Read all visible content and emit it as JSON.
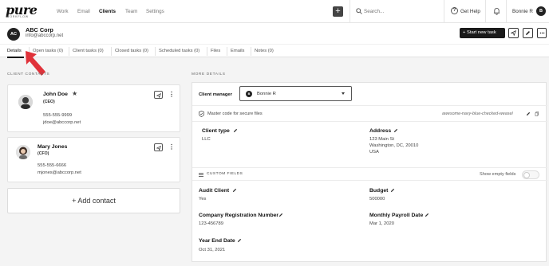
{
  "brand": {
    "logo_word": "pure",
    "logo_sub": "WORKFLOW"
  },
  "nav": {
    "links": [
      "Work",
      "Email",
      "Clients",
      "Team",
      "Settings"
    ],
    "search_placeholder": "Search...",
    "help_label": "Get Help",
    "user_name": "Bonnie R",
    "user_initial": "B"
  },
  "client": {
    "initials": "AC",
    "name": "ABC Corp",
    "email": "info@abccorp.net",
    "start_task_label": "+ Start new task"
  },
  "tabs": [
    "Details",
    "Open tasks (0)",
    "Client tasks (0)",
    "Closed tasks (0)",
    "Scheduled tasks (0)",
    "Files",
    "Emails",
    "Notes (0)"
  ],
  "contacts_section": {
    "title": "CLIENT CONTACTS",
    "contacts": [
      {
        "name": "John Doe",
        "role": "(CEO)",
        "phone": "555-555-9999",
        "email": "jdoe@abccorp.net"
      },
      {
        "name": "Mary Jones",
        "role": "(CFO)",
        "phone": "555-555-6666",
        "email": "mjones@abccorp.net"
      }
    ],
    "add_label": "+ Add contact"
  },
  "details": {
    "title": "MORE DETAILS",
    "client_manager_label": "Client manager",
    "client_manager_value": "Bonnie R",
    "client_manager_initial": "B",
    "master_code_label": "Master code for secure files",
    "master_code_value": "awesome-navy-blue-checked-weasel",
    "client_type_label": "Client type",
    "client_type_value": "LLC",
    "address_label": "Address",
    "address_line1": "123 Main St",
    "address_line2": "Washington, DC, 20010",
    "address_line3": "USA",
    "custom_fields_label": "CUSTOM FIELDS",
    "show_empty_label": "Show empty fields",
    "custom_fields": [
      {
        "label": "Audit Client",
        "value": "Yes"
      },
      {
        "label": "Budget",
        "value": "500000"
      },
      {
        "label": "Company Registration Number",
        "value": "123-456789"
      },
      {
        "label": "Monthly Payroll Date",
        "value": "Mar 1, 2020"
      },
      {
        "label": "Year End Date",
        "value": "Oct 31, 2021"
      }
    ]
  },
  "colors": {
    "dark": "#1a1a1a",
    "arrow": "#e0323a",
    "background": "#f4f4f4"
  }
}
